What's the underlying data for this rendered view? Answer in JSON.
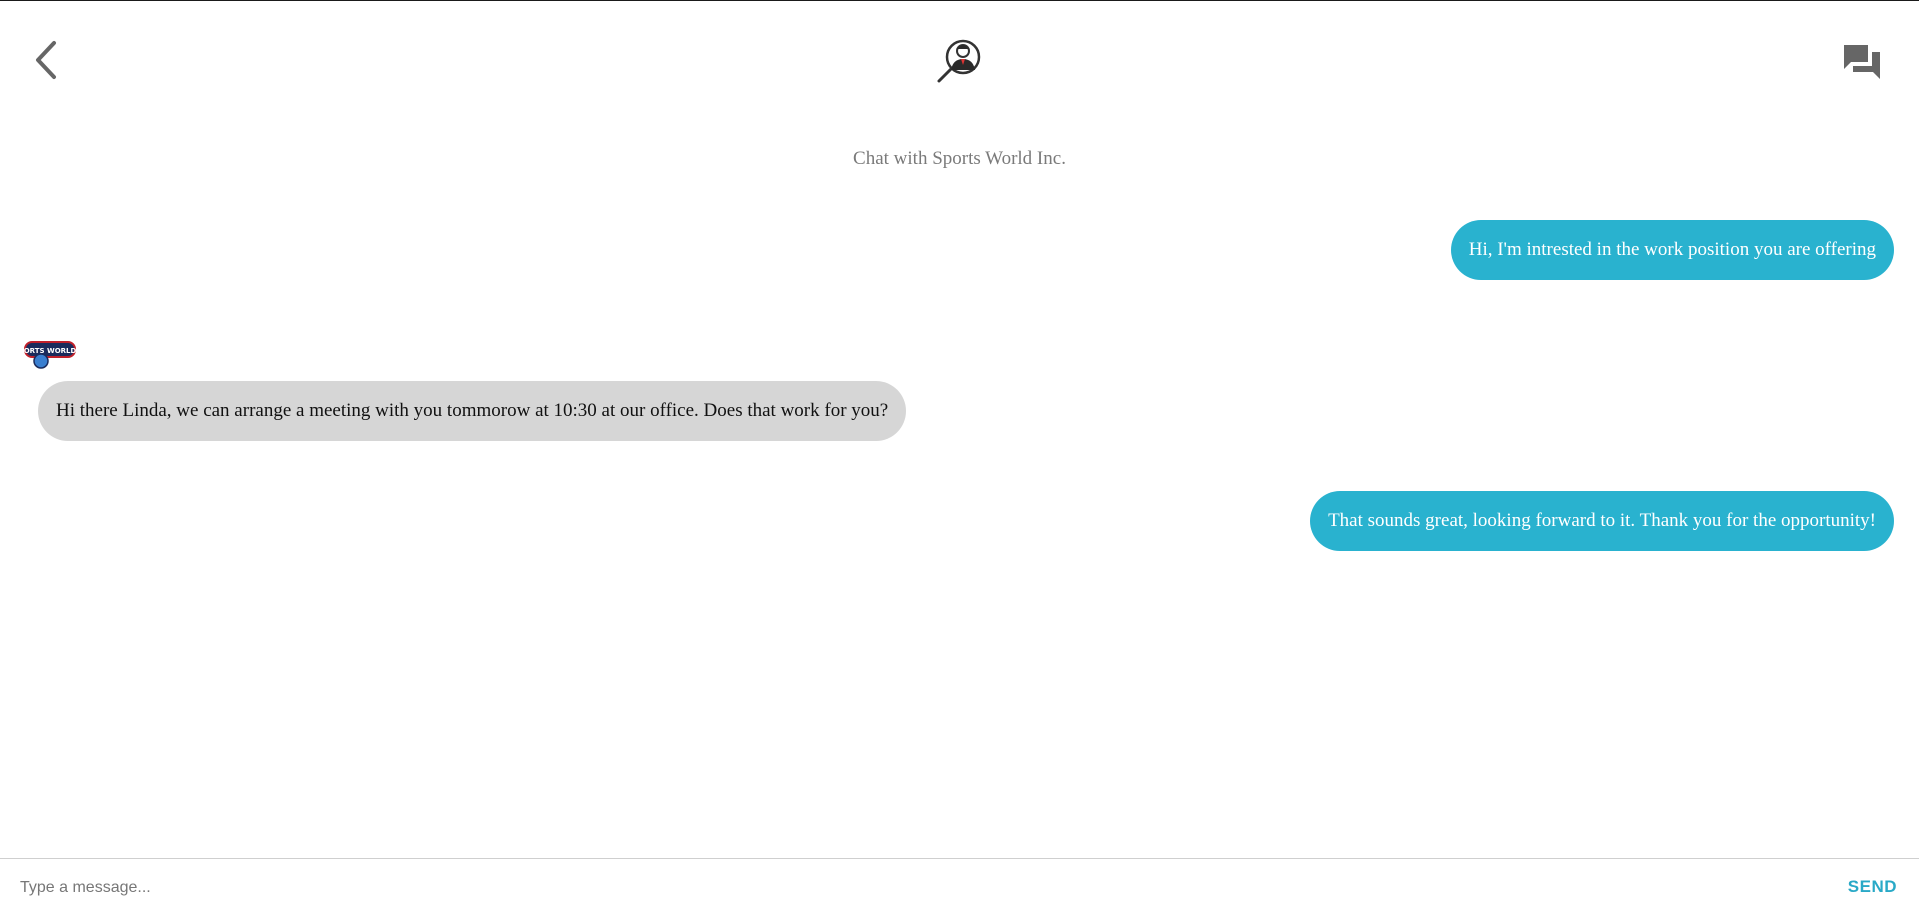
{
  "header": {
    "back_icon": "chevron-left-icon",
    "logo_icon": "magnifier-person-logo",
    "chats_icon": "forum-icon",
    "icon_color": "#666666"
  },
  "chat": {
    "title": "Chat with Sports World Inc.",
    "contact_logo_text": "ORTS WORLD",
    "messages": [
      {
        "direction": "out",
        "text": "Hi, I'm intrested in the work position you are offering"
      },
      {
        "direction": "in",
        "text": "Hi there Linda, we can arrange a meeting with you tommorow at 10:30 at our office. Does that work for you?"
      },
      {
        "direction": "out",
        "text": "That sounds great, looking forward to it. Thank you for the opportunity!"
      }
    ]
  },
  "composer": {
    "placeholder": "Type a message...",
    "value": "",
    "send_label": "SEND"
  },
  "colors": {
    "outgoing_bubble": "#29b2cf",
    "incoming_bubble": "#d6d6d6",
    "accent": "#29a9c7"
  }
}
